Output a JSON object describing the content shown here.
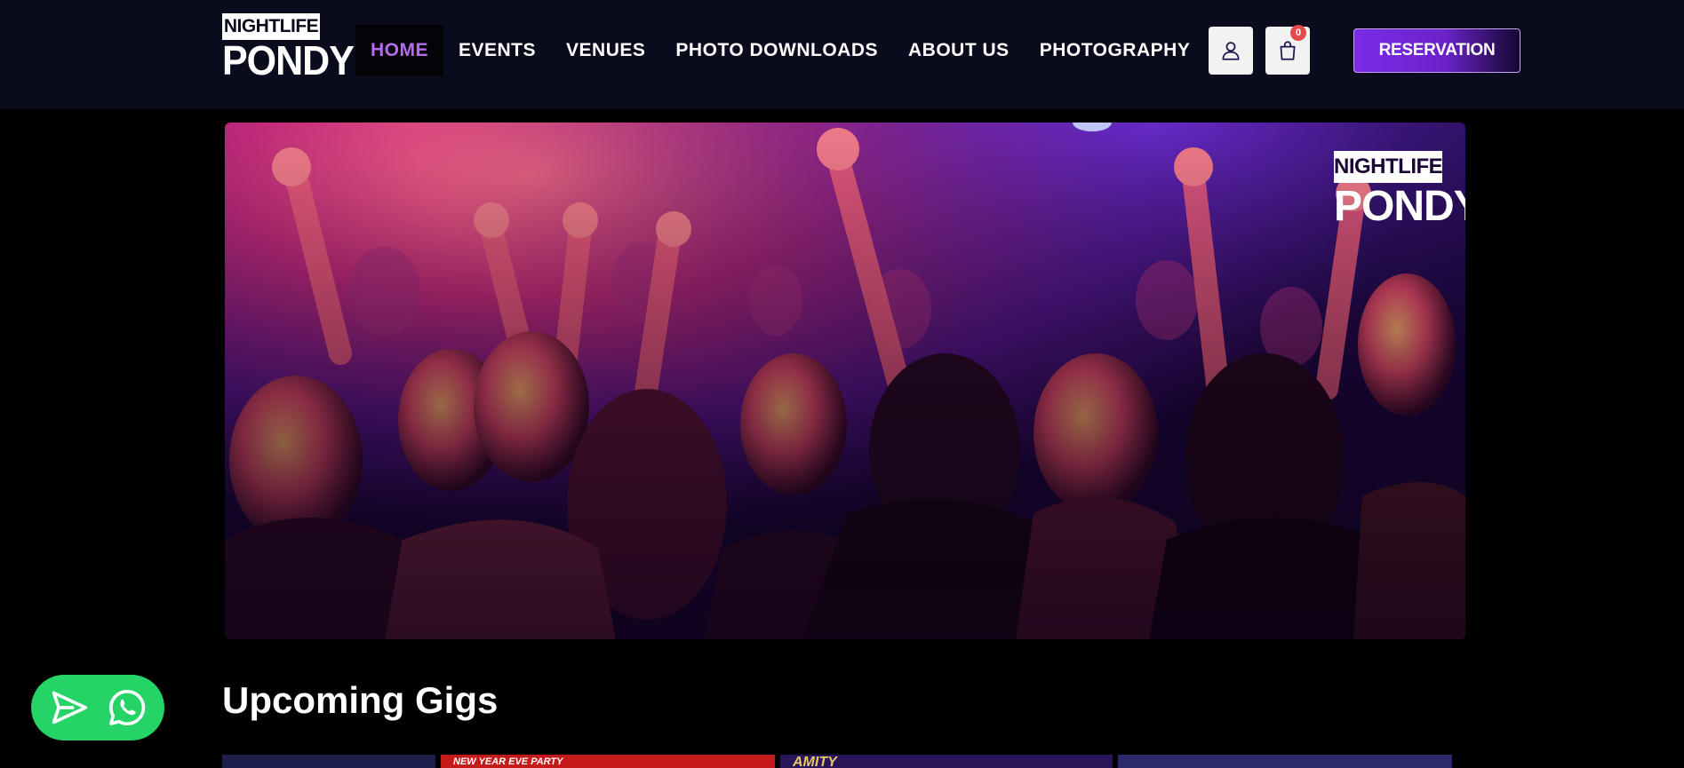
{
  "brand": {
    "logo_top": "NIGHTLIFE",
    "logo_bottom": "PONDY"
  },
  "nav": {
    "items": [
      {
        "label": "HOME",
        "active": true
      },
      {
        "label": "EVENTS",
        "active": false
      },
      {
        "label": "VENUES",
        "active": false
      },
      {
        "label": "PHOTO DOWNLOADS",
        "active": false
      },
      {
        "label": "ABOUT US",
        "active": false
      },
      {
        "label": "PHOTOGRAPHY",
        "active": false
      }
    ]
  },
  "header_actions": {
    "account_icon": "user-icon",
    "cart_icon": "shopping-bag-icon",
    "cart_count": "0",
    "reservation_label": "RESERVATION"
  },
  "hero": {
    "logo_top": "NIGHTLIFE",
    "logo_bottom": "PONDY"
  },
  "upcoming": {
    "title": "Upcoming Gigs",
    "cards": [
      {
        "text": "",
        "color": "#20204a"
      },
      {
        "text": "NEW YEAR EVE PARTY",
        "color": "#c51a1a"
      },
      {
        "text": "AMITY",
        "color": "#2a1a5a"
      },
      {
        "text": "",
        "color": "#2a2a6a"
      }
    ]
  },
  "floating": {
    "send_icon": "send-icon",
    "whatsapp_icon": "whatsapp-icon"
  },
  "colors": {
    "header_bg": "#0b0b1e",
    "accent": "#b76cf0",
    "reservation_gradient_start": "#7a2ce6",
    "whatsapp_green": "#25d366",
    "badge_red": "#e44a4a"
  }
}
